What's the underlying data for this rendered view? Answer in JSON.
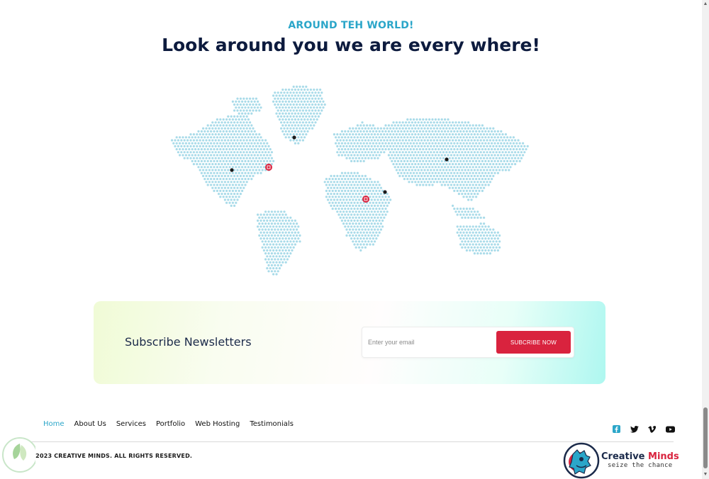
{
  "header": {
    "eyebrow": "AROUND TEH WORLD!",
    "headline": "Look around you we are every where!"
  },
  "newsletter": {
    "title": "Subscribe Newsletters",
    "email_placeholder": "Enter your email",
    "subscribe_label": "SUBCRIBE NOW"
  },
  "footer": {
    "nav": [
      {
        "label": "Home",
        "active": true
      },
      {
        "label": "About Us"
      },
      {
        "label": "Services"
      },
      {
        "label": "Portfolio"
      },
      {
        "label": "Web Hosting"
      },
      {
        "label": "Testimonials"
      }
    ],
    "social": [
      "facebook-icon",
      "twitter-icon",
      "vimeo-icon",
      "youtube-icon"
    ],
    "copyright": "© 2023 CREATIVE MINDS. ALL RIGHTS RESERVED.",
    "brand_name_primary": "Creative ",
    "brand_name_accent": "Minds",
    "brand_tagline": "seize the chance"
  },
  "colors": {
    "accent": "#2ba6c9",
    "heading": "#0d1b3e",
    "button": "#d9233e",
    "map_dot": "#a9dbe9",
    "map_marker": "#d9233e"
  }
}
